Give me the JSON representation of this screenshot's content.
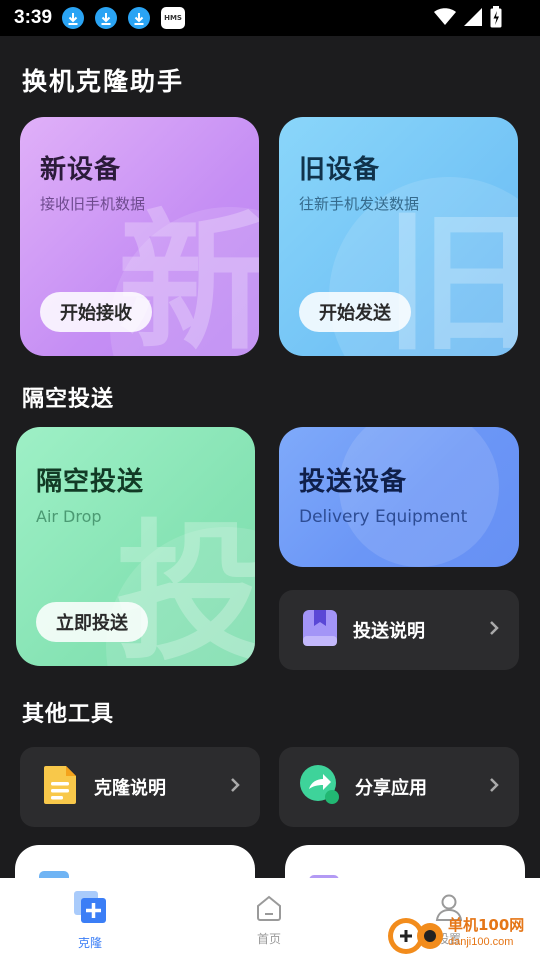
{
  "status_bar": {
    "time": "3:39",
    "hms_label": "HMS"
  },
  "page_title": "换机克隆助手",
  "new_device": {
    "title": "新设备",
    "subtitle": "接收旧手机数据",
    "button": "开始接收",
    "watermark": "新"
  },
  "old_device": {
    "title": "旧设备",
    "subtitle": "往新手机发送数据",
    "button": "开始发送",
    "watermark": "旧"
  },
  "section_airdrop": "隔空投送",
  "airdrop": {
    "title": "隔空投送",
    "subtitle": "Air Drop",
    "button": "立即投送",
    "watermark": "投"
  },
  "delivery": {
    "title": "投送设备",
    "subtitle": "Delivery Equipment"
  },
  "delivery_help": {
    "label": "投送说明"
  },
  "section_tools": "其他工具",
  "tools": [
    {
      "label": "克隆说明"
    },
    {
      "label": "分享应用"
    }
  ],
  "nav": {
    "clone": "克隆",
    "home": "首页",
    "settings": "设置"
  },
  "site_watermark": {
    "name": "单机100网",
    "url": "danji100.com"
  },
  "colors": {
    "background": "#1c1c1e",
    "card_purple": "#c98af6",
    "card_blue": "#7cc8f8",
    "card_green": "#8ee7b8",
    "card_indigo": "#7b9ef8",
    "tool_bg": "#2c2c2e",
    "nav_active": "#3b7ef6"
  }
}
